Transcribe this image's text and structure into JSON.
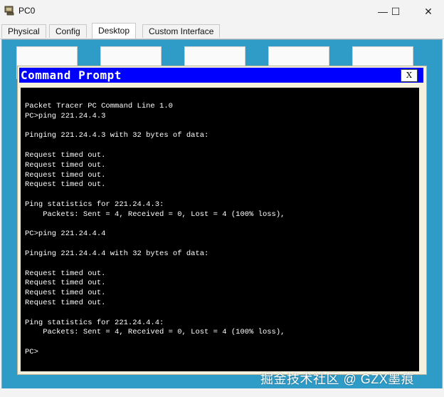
{
  "window": {
    "title": "PC0",
    "icon": "pc-device-icon",
    "minimize_glyph": "—",
    "maximize_glyph": "☐",
    "close_glyph": "✕"
  },
  "tabs": [
    {
      "label": "Physical",
      "active": false
    },
    {
      "label": "Config",
      "active": false
    },
    {
      "label": "Desktop",
      "active": true
    },
    {
      "label": "Custom Interface",
      "active": false
    }
  ],
  "command_prompt": {
    "title": "Command Prompt",
    "close_label": "X",
    "lines": [
      "Packet Tracer PC Command Line 1.0",
      "PC>ping 221.24.4.3",
      "",
      "Pinging 221.24.4.3 with 32 bytes of data:",
      "",
      "Request timed out.",
      "Request timed out.",
      "Request timed out.",
      "Request timed out.",
      "",
      "Ping statistics for 221.24.4.3:",
      "    Packets: Sent = 4, Received = 0, Lost = 4 (100% loss),",
      "",
      "PC>ping 221.24.4.4",
      "",
      "Pinging 221.24.4.4 with 32 bytes of data:",
      "",
      "Request timed out.",
      "Request timed out.",
      "Request timed out.",
      "Request timed out.",
      "",
      "Ping statistics for 221.24.4.4:",
      "    Packets: Sent = 4, Received = 0, Lost = 4 (100% loss),",
      "",
      "PC>"
    ]
  },
  "watermark": "掘金技术社区 @ GZX墨痕",
  "colors": {
    "desktop_bg": "#2f9cc8",
    "cmd_title_bg": "#0000ff",
    "terminal_bg": "#000000",
    "terminal_fg": "#ffffff"
  }
}
